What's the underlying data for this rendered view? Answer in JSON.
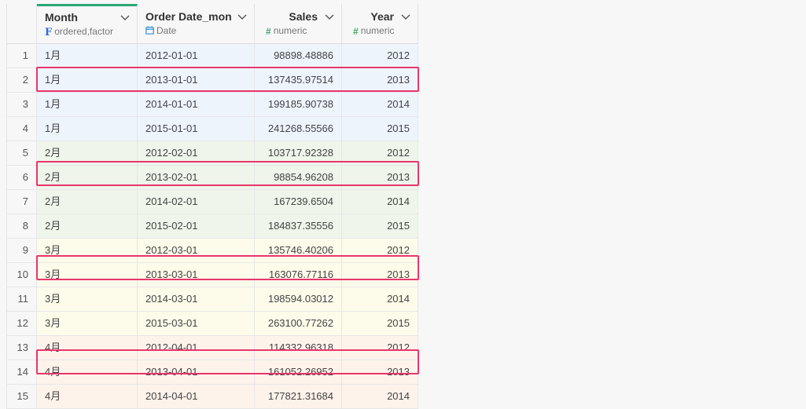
{
  "columns": [
    {
      "name": "Month",
      "type_icon": "factor-icon",
      "type": "ordered,factor"
    },
    {
      "name": "Order Date_mon",
      "type_icon": "calendar-icon",
      "type": "Date"
    },
    {
      "name": "Sales",
      "type_icon": "numeric-hash-icon",
      "type": "numeric"
    },
    {
      "name": "Year",
      "type_icon": "numeric-hash-icon",
      "type": "numeric"
    }
  ],
  "rows": [
    {
      "n": "1",
      "month": "1月",
      "date": "2012-01-01",
      "sales": "98898.48886",
      "year": "2012"
    },
    {
      "n": "2",
      "month": "1月",
      "date": "2013-01-01",
      "sales": "137435.97514",
      "year": "2013"
    },
    {
      "n": "3",
      "month": "1月",
      "date": "2014-01-01",
      "sales": "199185.90738",
      "year": "2014"
    },
    {
      "n": "4",
      "month": "1月",
      "date": "2015-01-01",
      "sales": "241268.55566",
      "year": "2015"
    },
    {
      "n": "5",
      "month": "2月",
      "date": "2012-02-01",
      "sales": "103717.92328",
      "year": "2012"
    },
    {
      "n": "6",
      "month": "2月",
      "date": "2013-02-01",
      "sales": "98854.96208",
      "year": "2013"
    },
    {
      "n": "7",
      "month": "2月",
      "date": "2014-02-01",
      "sales": "167239.6504",
      "year": "2014"
    },
    {
      "n": "8",
      "month": "2月",
      "date": "2015-02-01",
      "sales": "184837.35556",
      "year": "2015"
    },
    {
      "n": "9",
      "month": "3月",
      "date": "2012-03-01",
      "sales": "135746.40206",
      "year": "2012"
    },
    {
      "n": "10",
      "month": "3月",
      "date": "2013-03-01",
      "sales": "163076.77116",
      "year": "2013"
    },
    {
      "n": "11",
      "month": "3月",
      "date": "2014-03-01",
      "sales": "198594.03012",
      "year": "2014"
    },
    {
      "n": "12",
      "month": "3月",
      "date": "2015-03-01",
      "sales": "263100.77262",
      "year": "2015"
    },
    {
      "n": "13",
      "month": "4月",
      "date": "2012-04-01",
      "sales": "114332.96318",
      "year": "2012"
    },
    {
      "n": "14",
      "month": "4月",
      "date": "2013-04-01",
      "sales": "161052.26952",
      "year": "2013"
    },
    {
      "n": "15",
      "month": "4月",
      "date": "2014-04-01",
      "sales": "177821.31684",
      "year": "2014"
    }
  ],
  "row_group_colors": {
    "1月": "#eef4fc",
    "2月": "#eff5ea",
    "3月": "#fdfbea",
    "4月": "#fdf3ea"
  },
  "highlight_color": "#e8366b",
  "active_column_color": "#2aa876"
}
